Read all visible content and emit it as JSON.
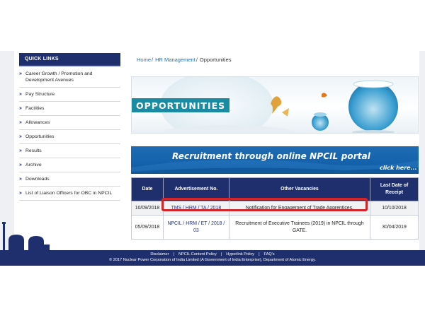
{
  "quick_links": {
    "title": "QUICK LINKS",
    "items": [
      {
        "label": "Career Growth / Promotion and Development Avenues"
      },
      {
        "label": "Pay Structure"
      },
      {
        "label": "Facilities"
      },
      {
        "label": "Allowances"
      },
      {
        "label": "Opportunities"
      },
      {
        "label": "Results"
      },
      {
        "label": "Archive"
      },
      {
        "label": "Downloads"
      },
      {
        "label": "List of Liaison Officers for OBC in NPCIL"
      }
    ]
  },
  "breadcrumb": {
    "home": "Home",
    "section": "HR Management",
    "current": "Opportunities",
    "separator": "/"
  },
  "opportunities_banner": {
    "label": "OPPORTUNITIES"
  },
  "recruitment_banner": {
    "title": "Recruitment through online NPCIL portal",
    "cta": "click here..."
  },
  "vacancy_table": {
    "headers": {
      "date": "Date",
      "advertisement": "Advertisement No.",
      "vacancies": "Other Vacancies",
      "last_date": "Last Date of Receipt"
    },
    "rows": [
      {
        "date": "10/09/2018",
        "advertisement": "TMS / HRM / TA / 2018",
        "vacancies": "Notification for Engagement of Trade Apprentices.",
        "last_date": "10/10/2018"
      },
      {
        "date": "05/09/2018",
        "advertisement": "NPCIL / HRM / ET / 2018 / 03",
        "vacancies": "Recruitment of Executive Trainees (2019) in NPCIL through GATE.",
        "last_date": "30/04/2019"
      }
    ],
    "highlight_color": "#d2242b"
  },
  "footer": {
    "links": [
      "Disclaimer",
      "NPCIL Content Policy",
      "Hyperlink Policy",
      "FAQ's"
    ],
    "separator": "|",
    "copyright": "© 2017 Nuclear Power Corporation of India Limited (A Government of India Enterprise), Department of Atomic Energy."
  },
  "colors": {
    "navy": "#1f2f6e",
    "link_blue": "#2a6fb5",
    "teal": "#1a8ba3",
    "banner_blue": "#1664ad",
    "highlight_red": "#d2242b"
  },
  "icons": {
    "quick_link_bullet": "double-chevron-right-icon"
  }
}
